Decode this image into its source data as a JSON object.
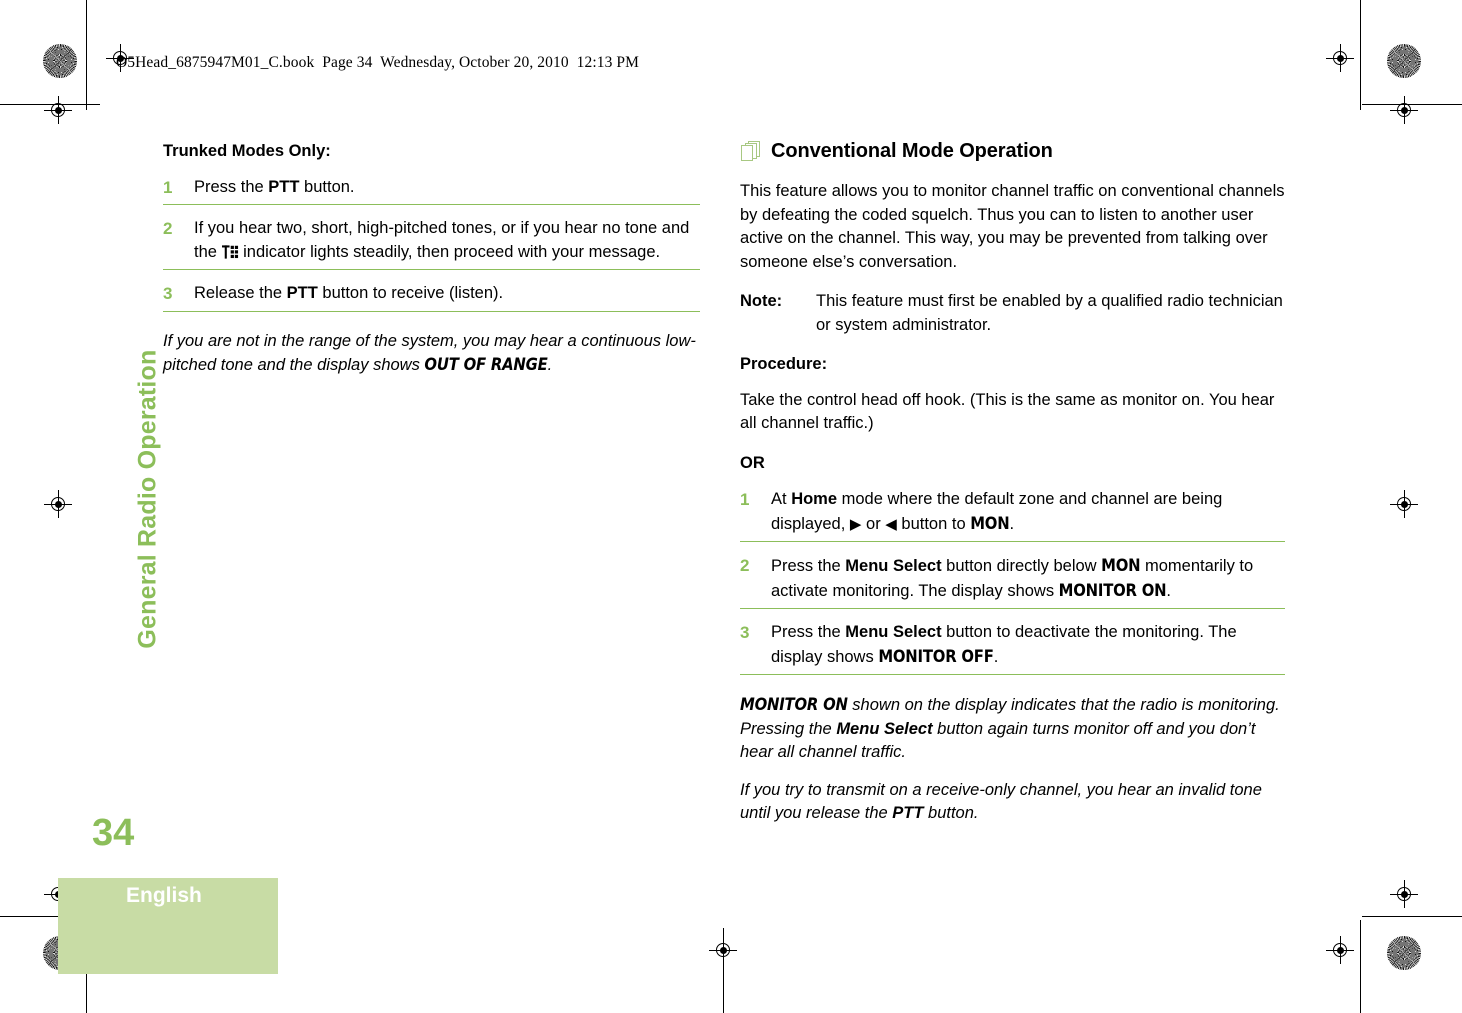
{
  "header": {
    "running_head": "O5Head_6875947M01_C.book  Page 34  Wednesday, October 20, 2010  12:13 PM"
  },
  "sidebar": {
    "chapter_title": "General Radio Operation",
    "page_number": "34",
    "language": "English",
    "accent_color": "#8CBE5A",
    "block_color": "#C8DCA5"
  },
  "left_column": {
    "subhead": "Trunked Modes Only:",
    "steps": [
      {
        "number": "1",
        "parts": [
          {
            "text": "Press the ",
            "style": "normal"
          },
          {
            "text": "PTT",
            "style": "bold"
          },
          {
            "text": " button.",
            "style": "normal"
          }
        ]
      },
      {
        "number": "2",
        "parts": [
          {
            "text": "If you hear two, short, high-pitched tones, or if you hear no tone and the ",
            "style": "normal"
          },
          {
            "text": "trunking-indicator-icon",
            "style": "icon"
          },
          {
            "text": " indicator lights steadily, then proceed with your message.",
            "style": "normal"
          }
        ]
      },
      {
        "number": "3",
        "parts": [
          {
            "text": "Release the ",
            "style": "normal"
          },
          {
            "text": "PTT",
            "style": "bold"
          },
          {
            "text": " button to receive (listen).",
            "style": "normal"
          }
        ]
      }
    ],
    "closing_note": [
      {
        "text": "If you are not in the range of the system, you may hear a continuous low-pitched tone and the display shows ",
        "style": "italic"
      },
      {
        "text": "OUT OF RANGE",
        "style": "lcd-italic"
      },
      {
        "text": ".",
        "style": "italic"
      }
    ]
  },
  "right_column": {
    "section_heading": "Conventional Mode Operation",
    "section_icon": "stacked-pages-icon",
    "intro": "This feature allows you to monitor channel traffic on conventional channels by defeating the coded squelch. Thus you can to listen to another user active on the channel. This way, you may be prevented from talking over someone else’s conversation.",
    "note_label": "Note:",
    "note_body": "This feature must first be enabled by a qualified radio technician or system administrator.",
    "procedure_label": "Procedure:",
    "procedure_intro": "Take the control head off hook. (This is the same as monitor on. You hear all channel traffic.)",
    "or_label": "OR",
    "steps": [
      {
        "number": "1",
        "parts": [
          {
            "text": "At ",
            "style": "normal"
          },
          {
            "text": "Home",
            "style": "bold"
          },
          {
            "text": " mode where the default zone and channel are being displayed, ",
            "style": "normal"
          },
          {
            "text": "▶",
            "style": "arrow"
          },
          {
            "text": " or ",
            "style": "normal"
          },
          {
            "text": "◀",
            "style": "arrow"
          },
          {
            "text": " button to ",
            "style": "normal"
          },
          {
            "text": "MON",
            "style": "lcd"
          },
          {
            "text": ".",
            "style": "normal"
          }
        ]
      },
      {
        "number": "2",
        "parts": [
          {
            "text": "Press the ",
            "style": "normal"
          },
          {
            "text": "Menu Select",
            "style": "bold"
          },
          {
            "text": " button directly below ",
            "style": "normal"
          },
          {
            "text": "MON",
            "style": "lcd"
          },
          {
            "text": " momentarily to activate monitoring. The display shows ",
            "style": "normal"
          },
          {
            "text": "MONITOR ON",
            "style": "lcd"
          },
          {
            "text": ".",
            "style": "normal"
          }
        ]
      },
      {
        "number": "3",
        "parts": [
          {
            "text": "Press the ",
            "style": "normal"
          },
          {
            "text": "Menu Select",
            "style": "bold"
          },
          {
            "text": " button to deactivate the monitoring. The display shows ",
            "style": "normal"
          },
          {
            "text": "MONITOR OFF",
            "style": "lcd"
          },
          {
            "text": ".",
            "style": "normal"
          }
        ]
      }
    ],
    "closing_note_1": [
      {
        "text": "MONITOR ON",
        "style": "lcd-italic"
      },
      {
        "text": " shown on the display indicates that the radio is monitoring. Pressing the ",
        "style": "italic"
      },
      {
        "text": "Menu Select",
        "style": "bold-italic"
      },
      {
        "text": " button again turns monitor off and you don’t hear all channel traffic.",
        "style": "italic"
      }
    ],
    "closing_note_2": [
      {
        "text": "If you try to transmit on a receive-only channel, you hear an invalid tone until you release the ",
        "style": "italic"
      },
      {
        "text": "PTT",
        "style": "bold-italic"
      },
      {
        "text": " button.",
        "style": "italic"
      }
    ]
  }
}
